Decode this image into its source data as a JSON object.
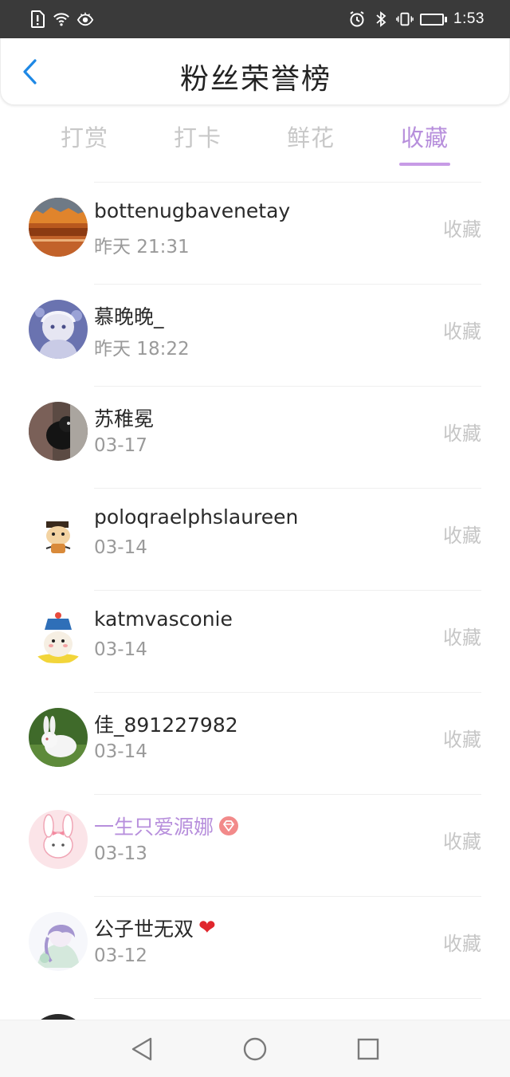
{
  "status_bar": {
    "time": "1:53",
    "battery_level": 0.45,
    "left_icons": [
      "alert-sim-icon",
      "wifi-icon",
      "eye-icon"
    ],
    "right_icons": [
      "alarm-icon",
      "bluetooth-icon",
      "vibrate-icon",
      "battery-icon"
    ]
  },
  "header": {
    "title": "粉丝荣誉榜",
    "back_icon": "chevron-left-icon",
    "accent_color": "#1e88e5"
  },
  "tabs": [
    {
      "label": "打赏",
      "active": false
    },
    {
      "label": "打卡",
      "active": false
    },
    {
      "label": "鲜花",
      "active": false
    },
    {
      "label": "收藏",
      "active": true
    }
  ],
  "tab_active_color": "#b78fdc",
  "rows": [
    {
      "name": "bottenugbavenetay",
      "time": "昨天 21:31",
      "action": "收藏",
      "avatar": "autumn-landscape-avatar"
    },
    {
      "name": "慕晚晚_",
      "time": "昨天 18:22",
      "action": "收藏",
      "avatar": "anime-girl-avatar"
    },
    {
      "name": "苏稚冕",
      "time": "03-17",
      "action": "收藏",
      "avatar": "dark-cat-avatar"
    },
    {
      "name": "poloqraelphslaureen",
      "time": "03-14",
      "action": "收藏",
      "avatar": "cartoon-sticker-avatar"
    },
    {
      "name": "katmvasconie",
      "time": "03-14",
      "action": "收藏",
      "avatar": "qing-official-cartoon-avatar"
    },
    {
      "name": "佳_891227982",
      "time": "03-14",
      "action": "收藏",
      "avatar": "white-rabbit-avatar"
    },
    {
      "name": "一生只爱源娜",
      "time": "03-13",
      "action": "收藏",
      "avatar": "pink-bunny-avatar",
      "vip": true,
      "badge": "diamond-badge-icon"
    },
    {
      "name": "公子世无双",
      "time": "03-12",
      "action": "收藏",
      "avatar": "watercolor-girl-avatar",
      "emoji": "❤"
    }
  ],
  "nav": {
    "back": "triangle-back-icon",
    "home": "circle-home-icon",
    "recents": "square-recents-icon"
  }
}
